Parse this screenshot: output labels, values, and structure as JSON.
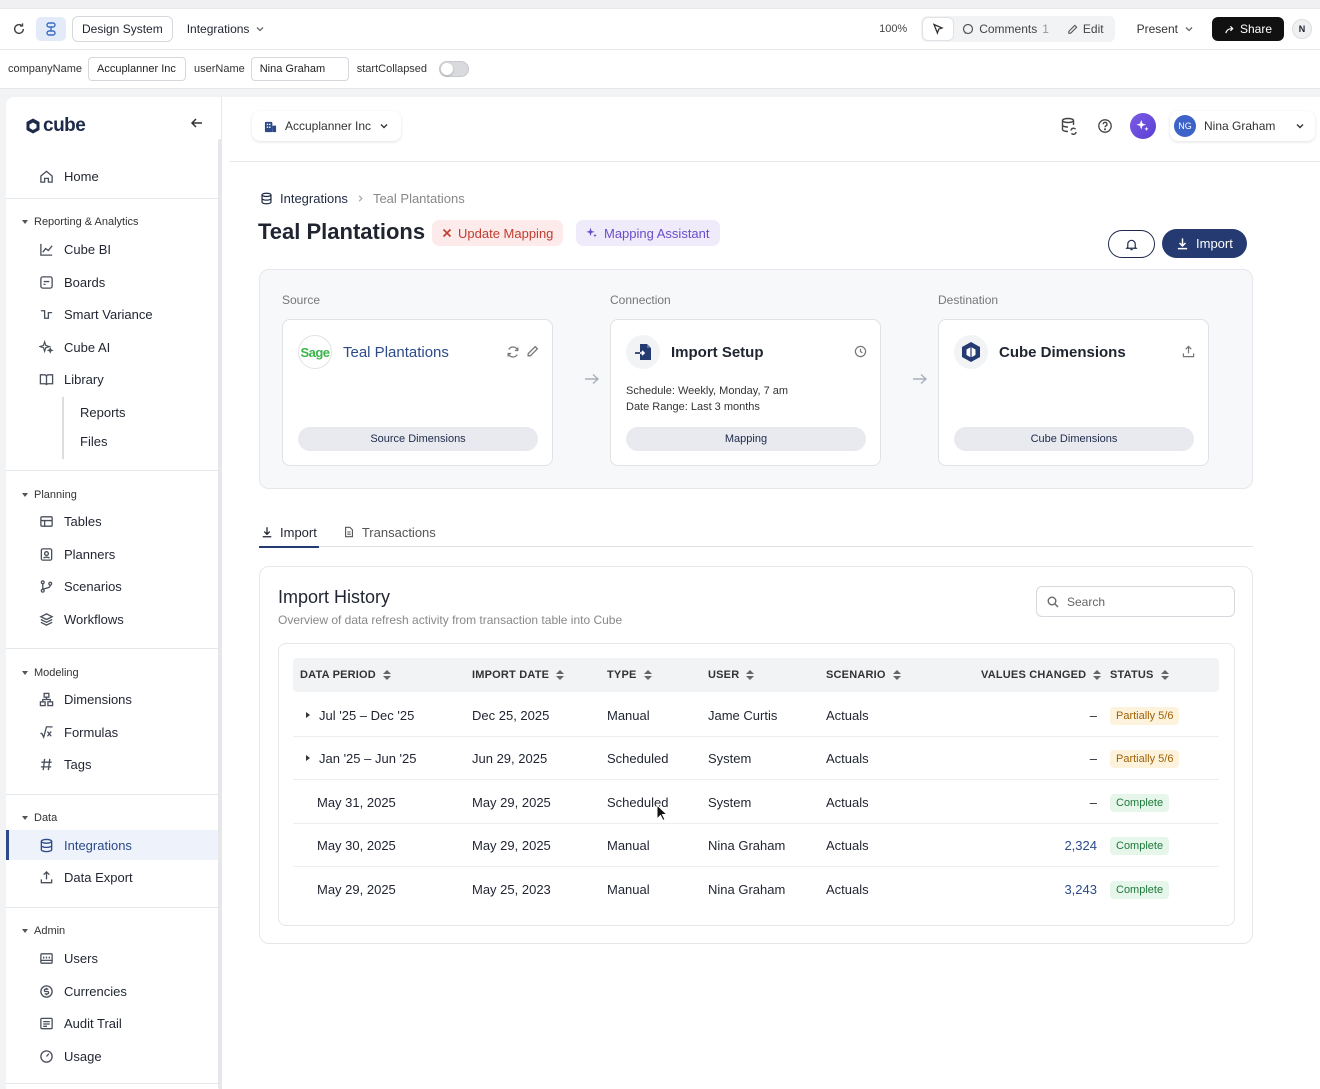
{
  "toolbar": {
    "project": "Design System",
    "page": "Integrations",
    "zoom": "100%",
    "comments_label": "Comments",
    "comments_count": "1",
    "edit_label": "Edit",
    "present_label": "Present",
    "share_label": "Share",
    "avatar_initial": "N"
  },
  "props": {
    "company_label": "companyName",
    "company_value": "Accuplanner Inc",
    "user_label": "userName",
    "user_value": "Nina Graham",
    "collapsed_label": "startCollapsed"
  },
  "sidebar": {
    "logo": "cube",
    "home": "Home",
    "groups": {
      "reporting": "Reporting & Analytics",
      "planning": "Planning",
      "modeling": "Modeling",
      "data": "Data",
      "admin": "Admin"
    },
    "items": {
      "cube_bi": "Cube BI",
      "boards": "Boards",
      "smart_variance": "Smart Variance",
      "cube_ai": "Cube AI",
      "library": "Library",
      "reports": "Reports",
      "files": "Files",
      "tables": "Tables",
      "planners": "Planners",
      "scenarios": "Scenarios",
      "workflows": "Workflows",
      "dimensions": "Dimensions",
      "formulas": "Formulas",
      "tags": "Tags",
      "integrations": "Integrations",
      "data_export": "Data Export",
      "users": "Users",
      "currencies": "Currencies",
      "audit_trail": "Audit Trail",
      "usage": "Usage"
    }
  },
  "header": {
    "company": "Accuplanner Inc",
    "user_initials": "NG",
    "user_name": "Nina Graham"
  },
  "page": {
    "breadcrumb_root": "Integrations",
    "breadcrumb_current": "Teal Plantations",
    "title": "Teal Plantations",
    "update_mapping": "Update Mapping",
    "mapping_assistant": "Mapping Assistant",
    "import_button": "Import"
  },
  "flow": {
    "source_label": "Source",
    "connection_label": "Connection",
    "destination_label": "Destination",
    "source": {
      "logo_text": "Sage",
      "title": "Teal Plantations",
      "button": "Source Dimensions"
    },
    "connection": {
      "title": "Import Setup",
      "schedule_label": "Schedule:",
      "schedule_value": "Weekly, Monday, 7 am",
      "range_label": "Date Range:",
      "range_value": "Last 3 months",
      "button": "Mapping"
    },
    "destination": {
      "title": "Cube Dimensions",
      "button": "Cube Dimensions"
    }
  },
  "tabs": [
    {
      "label": "Import"
    },
    {
      "label": "Transactions"
    }
  ],
  "history": {
    "title": "Import History",
    "description": "Overview of data refresh activity from transaction table into Cube",
    "search_placeholder": "Search",
    "columns": [
      "DATA PERIOD",
      "IMPORT DATE",
      "TYPE",
      "USER",
      "SCENARIO",
      "VALUES CHANGED",
      "STATUS"
    ],
    "rows": [
      {
        "period": "Jul '25 – Dec '25",
        "import_date": "Dec 25, 2025",
        "type": "Manual",
        "user": "Jame Curtis",
        "scenario": "Actuals",
        "values": "–",
        "status": "Partially 5/6"
      },
      {
        "period": "Jan '25 – Jun '25",
        "import_date": "Jun 29, 2025",
        "type": "Scheduled",
        "user": "System",
        "scenario": "Actuals",
        "values": "–",
        "status": "Partially 5/6"
      },
      {
        "period": "May 31, 2025",
        "import_date": "May 29, 2025",
        "type": "Scheduled",
        "user": "System",
        "scenario": "Actuals",
        "values": "–",
        "status": "Complete"
      },
      {
        "period": "May 30, 2025",
        "import_date": "May 29, 2025",
        "type": "Manual",
        "user": "Nina Graham",
        "scenario": "Actuals",
        "values": "2,324",
        "status": "Complete"
      },
      {
        "period": "May 29, 2025",
        "import_date": "May 25, 2023",
        "type": "Manual",
        "user": "Nina Graham",
        "scenario": "Actuals",
        "values": "3,243",
        "status": "Complete"
      }
    ]
  },
  "colors": {
    "accent": "#243a70",
    "link": "#2c4a8a",
    "danger": "#c23b30",
    "assistant": "#6b4dc9",
    "partial": "#a16207",
    "complete": "#1d7a3a"
  }
}
